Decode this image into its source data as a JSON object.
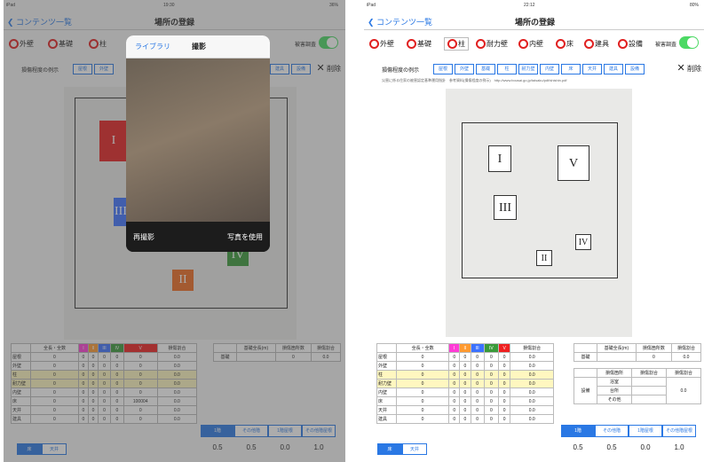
{
  "left": {
    "status": {
      "carrier": "iPad",
      "time": "19:30",
      "battery": "36%"
    },
    "nav": {
      "back": "コンテンツ一覧",
      "title": "場所の登録"
    },
    "categories": [
      "外壁",
      "基礎",
      "柱"
    ],
    "damage_label": "被害調査",
    "example_label": "損傷程度の例示",
    "example_buttons": [
      "屋根",
      "外壁"
    ],
    "example_buttons_right": [
      "建具",
      "設備"
    ],
    "delete_label": "削除",
    "popover": {
      "library": "ライブラリ",
      "camera": "撮影",
      "retake": "再撮影",
      "use_photo": "写真を使用"
    },
    "boxes": {
      "b1": "I",
      "b3": "III",
      "b4": "IV",
      "b2": "II"
    },
    "table_header": [
      "",
      "全長・全数",
      "I",
      "II",
      "III",
      "IV",
      "V",
      "損傷割合"
    ],
    "rows": [
      {
        "label": "屋根",
        "vals": [
          "0",
          "0",
          "0",
          "0",
          "0",
          "0",
          "0.0"
        ]
      },
      {
        "label": "外壁",
        "vals": [
          "0",
          "0",
          "0",
          "0",
          "0",
          "0",
          "0.0"
        ]
      },
      {
        "label": "柱",
        "vals": [
          "0",
          "0",
          "0",
          "0",
          "0",
          "0",
          "0.0"
        ]
      },
      {
        "label": "耐力壁",
        "vals": [
          "0",
          "0",
          "0",
          "0",
          "0",
          "0",
          "0.0"
        ]
      },
      {
        "label": "内壁",
        "vals": [
          "0",
          "0",
          "0",
          "0",
          "0",
          "0",
          "0.0"
        ]
      },
      {
        "label": "床",
        "vals": [
          "0",
          "0",
          "0",
          "0",
          "0",
          "100004",
          "0.0"
        ]
      },
      {
        "label": "天井",
        "vals": [
          "0",
          "0",
          "0",
          "0",
          "0",
          "0",
          "0.0"
        ]
      },
      {
        "label": "建具",
        "vals": [
          "0",
          "0",
          "0",
          "0",
          "0",
          "0",
          "0.0"
        ]
      }
    ],
    "foundation": {
      "h1": "基礎全長(m)",
      "h2": "損傷箇所数",
      "h3": "損傷割合",
      "label": "基礎",
      "v2": "0",
      "v3": "0.0"
    },
    "segments": [
      "1階",
      "その他階",
      "1階屋根",
      "その他階屋根"
    ],
    "seg_values": [
      "0.5",
      "0.5",
      "0.0",
      "1.0"
    ],
    "tabs": [
      "床",
      "天井"
    ]
  },
  "right": {
    "status": {
      "carrier": "iPad",
      "time": "22:12",
      "battery": "80%"
    },
    "nav": {
      "back": "コンテンツ一覧",
      "title": "場所の登録"
    },
    "categories": [
      "外壁",
      "基礎",
      "柱",
      "耐力壁",
      "内壁",
      "床",
      "建具",
      "設備"
    ],
    "damage_label": "被害調査",
    "example_label": "損傷程度の例示",
    "example_buttons": [
      "屋根",
      "外壁",
      "基礎",
      "柱",
      "耐力壁",
      "内壁",
      "床",
      "天井",
      "建具",
      "設備"
    ],
    "delete_label": "削除",
    "reference": "災害に係る住家の被害認定基準運用指針　参考資料(損傷程度の例示)　http://www.bousai.go.jp/taisaku/pdf/shishin.pdf",
    "boxes": {
      "b1": "I",
      "b5": "V",
      "b3": "III",
      "b4": "IV",
      "b2": "II"
    },
    "table_header": [
      "",
      "全長・全数",
      "I",
      "II",
      "III",
      "IV",
      "V",
      "損傷割合"
    ],
    "rows": [
      {
        "label": "屋根",
        "vals": [
          "0",
          "0",
          "0",
          "0",
          "0",
          "0",
          "0.0"
        ]
      },
      {
        "label": "外壁",
        "vals": [
          "0",
          "0",
          "0",
          "0",
          "0",
          "0",
          "0.0"
        ]
      },
      {
        "label": "柱",
        "vals": [
          "0",
          "0",
          "0",
          "0",
          "0",
          "0",
          "0.0"
        ]
      },
      {
        "label": "耐力壁",
        "vals": [
          "0",
          "0",
          "0",
          "0",
          "0",
          "0",
          "0.0"
        ]
      },
      {
        "label": "内壁",
        "vals": [
          "0",
          "0",
          "0",
          "0",
          "0",
          "0",
          "0.0"
        ]
      },
      {
        "label": "床",
        "vals": [
          "0",
          "0",
          "0",
          "0",
          "0",
          "0",
          "0.0"
        ]
      },
      {
        "label": "天井",
        "vals": [
          "0",
          "0",
          "0",
          "0",
          "0",
          "0",
          "0.0"
        ]
      },
      {
        "label": "建具",
        "vals": [
          "0",
          "0",
          "0",
          "0",
          "0",
          "0",
          "0.0"
        ]
      }
    ],
    "foundation": {
      "h1": "基礎全長(m)",
      "h2": "損傷箇所数",
      "h3": "損傷割合",
      "label": "基礎",
      "v2": "0",
      "v3": "0.0"
    },
    "equipment": {
      "h1": "損傷箇所",
      "h2": "損傷割合",
      "h3": "損傷割合",
      "label": "設備",
      "items": [
        "浴室",
        "台所",
        "その他"
      ],
      "value": "0.0"
    },
    "segments": [
      "1階",
      "その他階",
      "1階屋根",
      "その他階屋根"
    ],
    "seg_values": [
      "0.5",
      "0.5",
      "0.0",
      "1.0"
    ],
    "tabs": [
      "床",
      "天井"
    ]
  }
}
